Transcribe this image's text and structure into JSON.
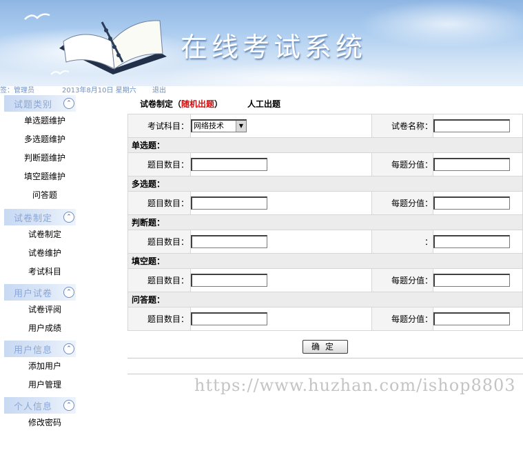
{
  "header": {
    "title": "在线考试系统"
  },
  "statusbar": {
    "user": "签：管理员",
    "date": "2013年8月10日 星期六",
    "logout": "退出"
  },
  "sidebar": {
    "sections": [
      {
        "title": "试题类别",
        "items": [
          "单选题维护",
          "多选题维护",
          "判断题维护",
          "填空题维护",
          "问答题"
        ]
      },
      {
        "title": "试卷制定",
        "items": [
          "试卷制定",
          "试卷维护",
          "考试科目"
        ]
      },
      {
        "title": "用户试卷",
        "items": [
          "试卷评阅",
          "用户成绩"
        ]
      },
      {
        "title": "用户信息",
        "items": [
          "添加用户",
          "用户管理"
        ]
      },
      {
        "title": "个人信息",
        "items": [
          "修改密码"
        ]
      }
    ]
  },
  "tabs": {
    "prefix": "试卷制定（",
    "random": "随机出题",
    "suffix": "）",
    "manual": "人工出题"
  },
  "form": {
    "subject_label": "考试科目：",
    "subject_value": "网络技术",
    "paper_name_label": "试卷名称：",
    "sections": [
      {
        "title": "单选题：",
        "count_label": "题目数目：",
        "score_label": "每题分值："
      },
      {
        "title": "多选题：",
        "count_label": "题目数目：",
        "score_label": "每题分值："
      },
      {
        "title": "判断题：",
        "count_label": "题目数目：",
        "score_label": "："
      },
      {
        "title": "填空题：",
        "count_label": "题目数目：",
        "score_label": "每题分值："
      },
      {
        "title": "问答题：",
        "count_label": "题目数目：",
        "score_label": "每题分值："
      }
    ],
    "confirm_label": "确定"
  },
  "watermark": "https://www.huzhan.com/ishop8803"
}
